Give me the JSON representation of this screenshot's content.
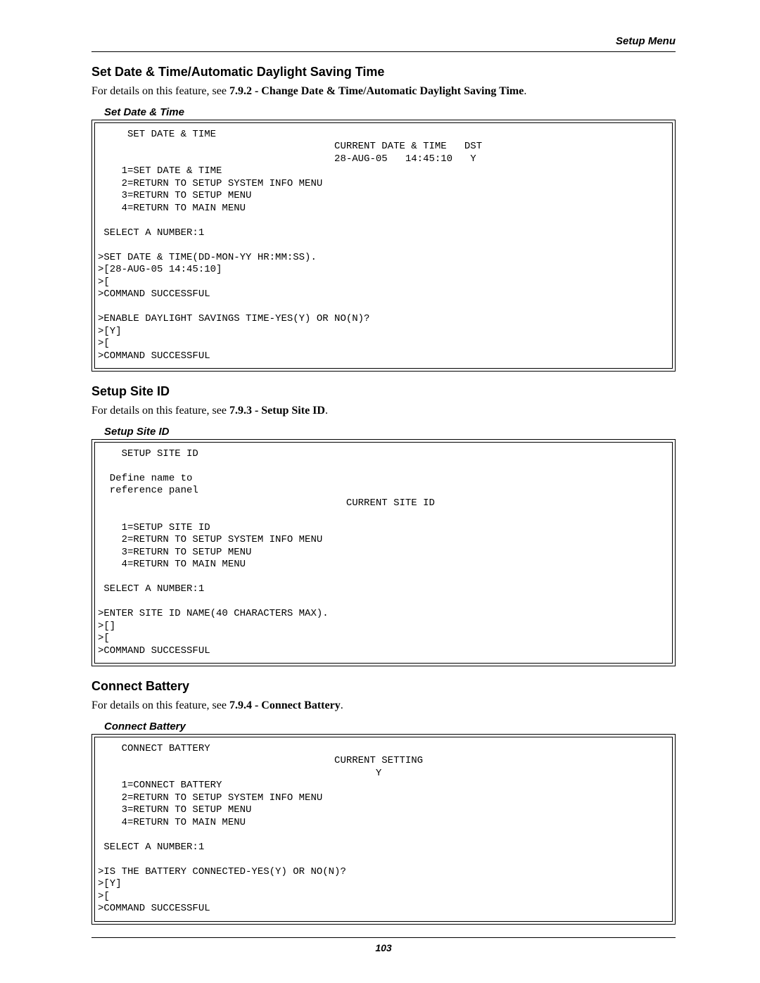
{
  "header": {
    "right": "Setup Menu"
  },
  "sections": [
    {
      "heading": "Set Date & Time/Automatic Daylight Saving Time",
      "body_prefix": "For details on this feature, see ",
      "body_ref": "7.9.2 - Change Date & Time/Automatic Daylight Saving Time",
      "body_suffix": ".",
      "caption": "Set Date & Time",
      "terminal": "     SET DATE & TIME\n                                        CURRENT DATE & TIME   DST\n                                        28-AUG-05   14:45:10   Y\n    1=SET DATE & TIME\n    2=RETURN TO SETUP SYSTEM INFO MENU\n    3=RETURN TO SETUP MENU\n    4=RETURN TO MAIN MENU\n\n SELECT A NUMBER:1\n\n>SET DATE & TIME(DD-MON-YY HR:MM:SS).\n>[28-AUG-05 14:45:10]\n>[\n>COMMAND SUCCESSFUL\n\n>ENABLE DAYLIGHT SAVINGS TIME-YES(Y) OR NO(N)?\n>[Y]\n>[\n>COMMAND SUCCESSFUL"
    },
    {
      "heading": "Setup Site ID",
      "body_prefix": "For details on this feature, see ",
      "body_ref": "7.9.3 - Setup Site ID",
      "body_suffix": ".",
      "caption": "Setup Site ID",
      "terminal": "    SETUP SITE ID\n\n  Define name to\n  reference panel\n                                          CURRENT SITE ID\n\n    1=SETUP SITE ID\n    2=RETURN TO SETUP SYSTEM INFO MENU\n    3=RETURN TO SETUP MENU\n    4=RETURN TO MAIN MENU\n\n SELECT A NUMBER:1\n\n>ENTER SITE ID NAME(40 CHARACTERS MAX).\n>[]\n>[\n>COMMAND SUCCESSFUL"
    },
    {
      "heading": "Connect Battery",
      "body_prefix": "For details on this feature, see ",
      "body_ref": "7.9.4 - Connect Battery",
      "body_suffix": ".",
      "caption": "Connect Battery",
      "terminal": "    CONNECT BATTERY\n                                        CURRENT SETTING\n                                               Y\n    1=CONNECT BATTERY\n    2=RETURN TO SETUP SYSTEM INFO MENU\n    3=RETURN TO SETUP MENU\n    4=RETURN TO MAIN MENU\n\n SELECT A NUMBER:1\n\n>IS THE BATTERY CONNECTED-YES(Y) OR NO(N)?\n>[Y]\n>[\n>COMMAND SUCCESSFUL"
    }
  ],
  "page_number": "103"
}
